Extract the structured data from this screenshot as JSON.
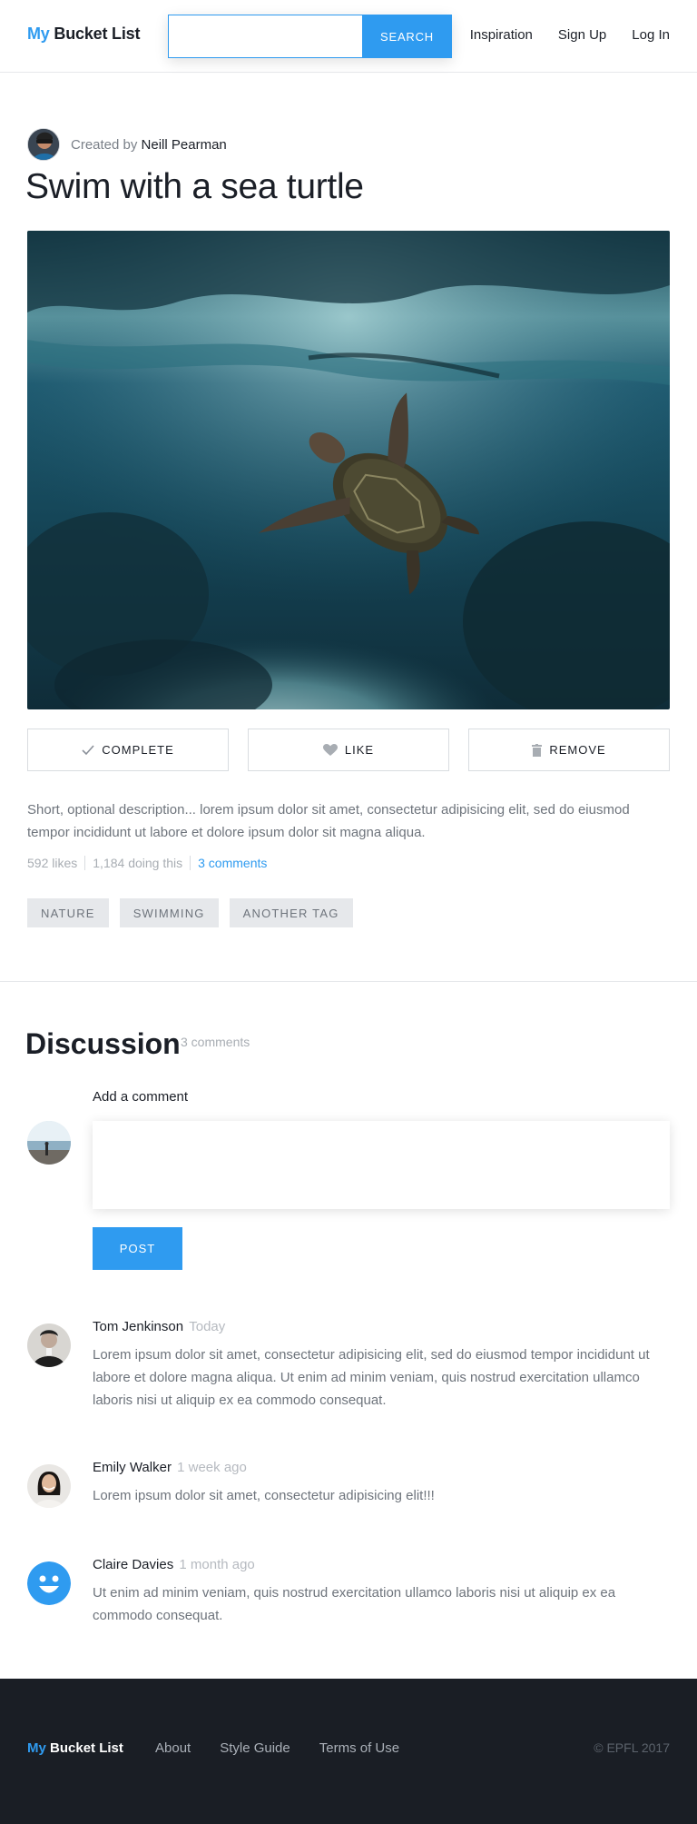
{
  "header": {
    "logo_my": "My",
    "logo_rest": "Bucket List",
    "search_placeholder": "",
    "search_button": "SEARCH",
    "nav": [
      "Inspiration",
      "Sign Up",
      "Log In"
    ]
  },
  "item": {
    "created_by_prefix": "Created by",
    "creator_name": "Neill Pearman",
    "title": "Swim with a sea turtle",
    "actions": {
      "complete": "COMPLETE",
      "like": "LIKE",
      "remove": "REMOVE"
    },
    "description": "Short, optional description... lorem ipsum dolor sit amet, consectetur adipisicing elit, sed do eiusmod tempor incididunt ut labore et dolore ipsum dolor sit magna aliqua.",
    "stats": {
      "likes": "592 likes",
      "doing": "1,184 doing this",
      "comments_link": "3 comments"
    },
    "tags": [
      "NATURE",
      "SWIMMING",
      "ANOTHER TAG"
    ]
  },
  "discussion": {
    "title": "Discussion",
    "count": "3 comments",
    "add_label": "Add a comment",
    "comment_placeholder": "",
    "post_button": "POST",
    "comments": [
      {
        "author": "Tom Jenkinson",
        "when": "Today",
        "text": "Lorem ipsum dolor sit amet, consectetur adipisicing elit, sed do eiusmod tempor incididunt ut labore et dolore magna aliqua. Ut enim ad minim veniam, quis nostrud exercitation ullamco laboris nisi ut aliquip ex ea commodo consequat."
      },
      {
        "author": "Emily Walker",
        "when": "1 week ago",
        "text": "Lorem ipsum dolor sit amet, consectetur adipisicing elit!!!"
      },
      {
        "author": "Claire Davies",
        "when": "1 month ago",
        "text": "Ut enim ad minim veniam, quis nostrud exercitation ullamco laboris nisi ut aliquip ex ea commodo consequat."
      }
    ]
  },
  "footer": {
    "logo_my": "My",
    "logo_rest": "Bucket List",
    "links": [
      "About",
      "Style Guide",
      "Terms of Use"
    ],
    "copyright": "© EPFL 2017"
  },
  "colors": {
    "accent": "#2f9bf0",
    "footer_bg": "#1a1e25",
    "text": "#1b1f27",
    "muted": "#6e747c"
  }
}
